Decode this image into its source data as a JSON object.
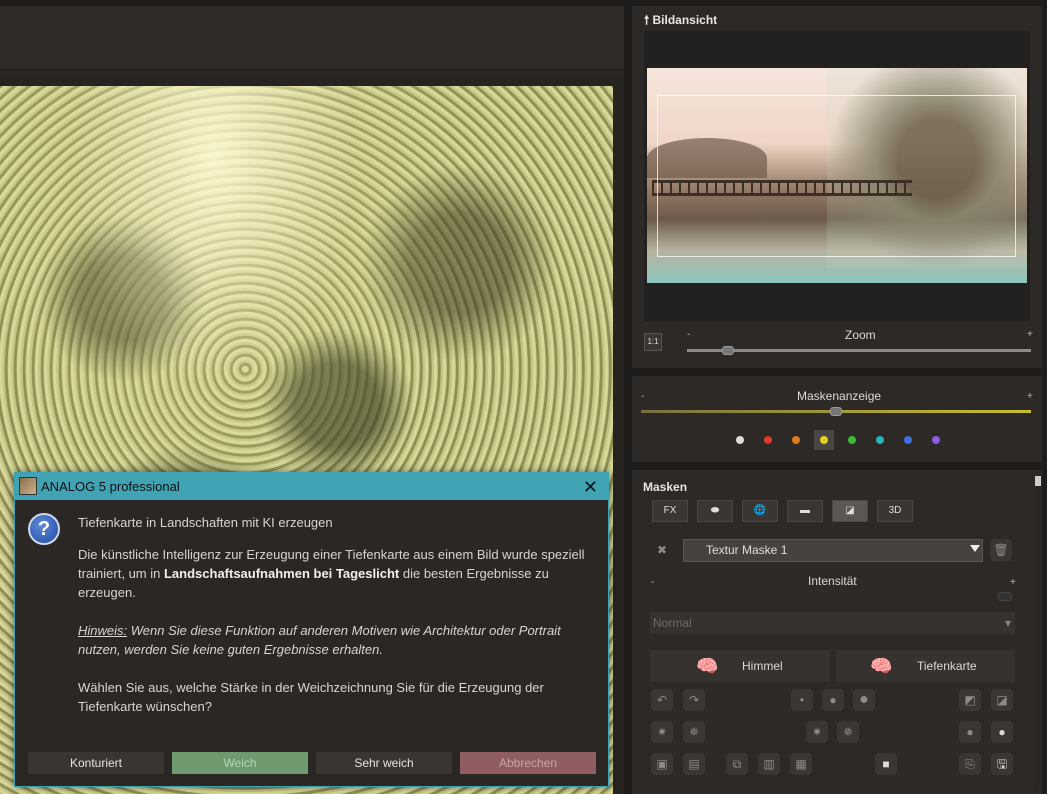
{
  "preview": {
    "title": "Bildansicht",
    "one_to_one": "1:1",
    "zoom_label": "Zoom",
    "zoom_value": 0.12
  },
  "mask_display": {
    "label": "Maskenanzeige",
    "minus": "-",
    "plus": "+",
    "value": 0.5,
    "colors": [
      "#dddddd",
      "#e03a2e",
      "#e07a1c",
      "#e3d21e",
      "#3dbb3d",
      "#28b5b5",
      "#3f6fe0",
      "#8a5ee0"
    ],
    "selected_index": 3
  },
  "masks": {
    "title": "Masken",
    "toolbar": [
      "FX",
      "",
      "",
      "",
      "",
      "3D"
    ],
    "selected_tool": 4,
    "mask_name": "Textur Maske 1",
    "intensity_label": "Intensität",
    "blend_mode": "Normal",
    "sky_button": "Himmel",
    "depth_button": "Tiefenkarte"
  },
  "dialog": {
    "title": "ANALOG 5 professional",
    "heading": "Tiefenkarte in Landschaften mit KI erzeugen",
    "p1_a": "Die künstliche Intelligenz zur Erzeugung einer Tiefenkarte aus einem Bild wurde speziell",
    "p1_b_pre": "trainiert, um in ",
    "p1_b_bold": "Landschaftsaufnahmen bei Tageslicht",
    "p1_b_post": " die besten Ergebnisse zu",
    "p1_c": "erzeugen.",
    "hint_label": "Hinweis:",
    "hint_a": " Wenn Sie diese Funktion auf anderen Motiven wie Architektur oder Portrait",
    "hint_b": "nutzen, werden Sie keine guten Ergebnisse erhalten.",
    "p3_a": "Wählen Sie aus, welche Stärke in der Weichzeichnung Sie für die Erzeugung der",
    "p3_b": "Tiefenkarte wünschen?",
    "buttons": {
      "contoured": "Konturiert",
      "soft": "Weich",
      "very_soft": "Sehr weich",
      "cancel": "Abbrechen"
    }
  }
}
